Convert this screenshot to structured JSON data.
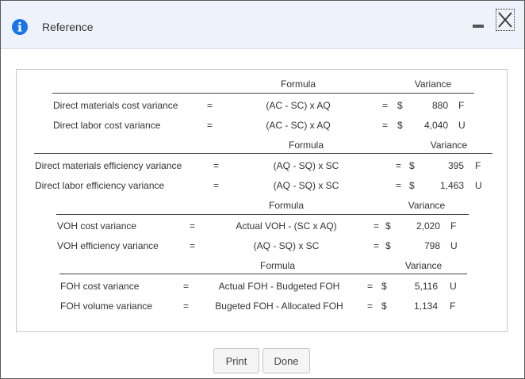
{
  "window": {
    "title": "Reference"
  },
  "sections": [
    {
      "formula_header": "Formula",
      "variance_header": "Variance",
      "rows": [
        {
          "label": "Direct materials cost variance",
          "eq": "=",
          "formula": "(AC - SC) x AQ",
          "eq2": "=",
          "currency": "$",
          "amount": "880",
          "flag": "F"
        },
        {
          "label": "Direct labor cost variance",
          "eq": "=",
          "formula": "(AC - SC) x AQ",
          "eq2": "=",
          "currency": "$",
          "amount": "4,040",
          "flag": "U"
        }
      ]
    },
    {
      "formula_header": "Formula",
      "variance_header": "Variance",
      "rows": [
        {
          "label": "Direct materials efficiency variance",
          "eq": "=",
          "formula": "(AQ - SQ) x SC",
          "eq2": "=",
          "currency": "$",
          "amount": "395",
          "flag": "F"
        },
        {
          "label": "Direct labor efficiency variance",
          "eq": "=",
          "formula": "(AQ - SQ) x SC",
          "eq2": "=",
          "currency": "$",
          "amount": "1,463",
          "flag": "U"
        }
      ]
    },
    {
      "formula_header": "Formula",
      "variance_header": "Variance",
      "rows": [
        {
          "label": "VOH cost variance",
          "eq": "=",
          "formula": "Actual VOH - (SC x AQ)",
          "eq2": "=",
          "currency": "$",
          "amount": "2,020",
          "flag": "F"
        },
        {
          "label": "VOH efficiency variance",
          "eq": "=",
          "formula": "(AQ - SQ) x SC",
          "eq2": "=",
          "currency": "$",
          "amount": "798",
          "flag": "U"
        }
      ]
    },
    {
      "formula_header": "Formula",
      "variance_header": "Variance",
      "rows": [
        {
          "label": "FOH cost variance",
          "eq": "=",
          "formula": "Actual FOH - Budgeted FOH",
          "eq2": "=",
          "currency": "$",
          "amount": "5,116",
          "flag": "U"
        },
        {
          "label": "FOH volume variance",
          "eq": "=",
          "formula": "Bugeted FOH - Allocated FOH",
          "eq2": "=",
          "currency": "$",
          "amount": "1,134",
          "flag": "F"
        }
      ]
    }
  ],
  "buttons": {
    "print": "Print",
    "done": "Done"
  },
  "colors": {
    "info_icon": "#1a73e8",
    "titlebar": "#eef3fb"
  }
}
